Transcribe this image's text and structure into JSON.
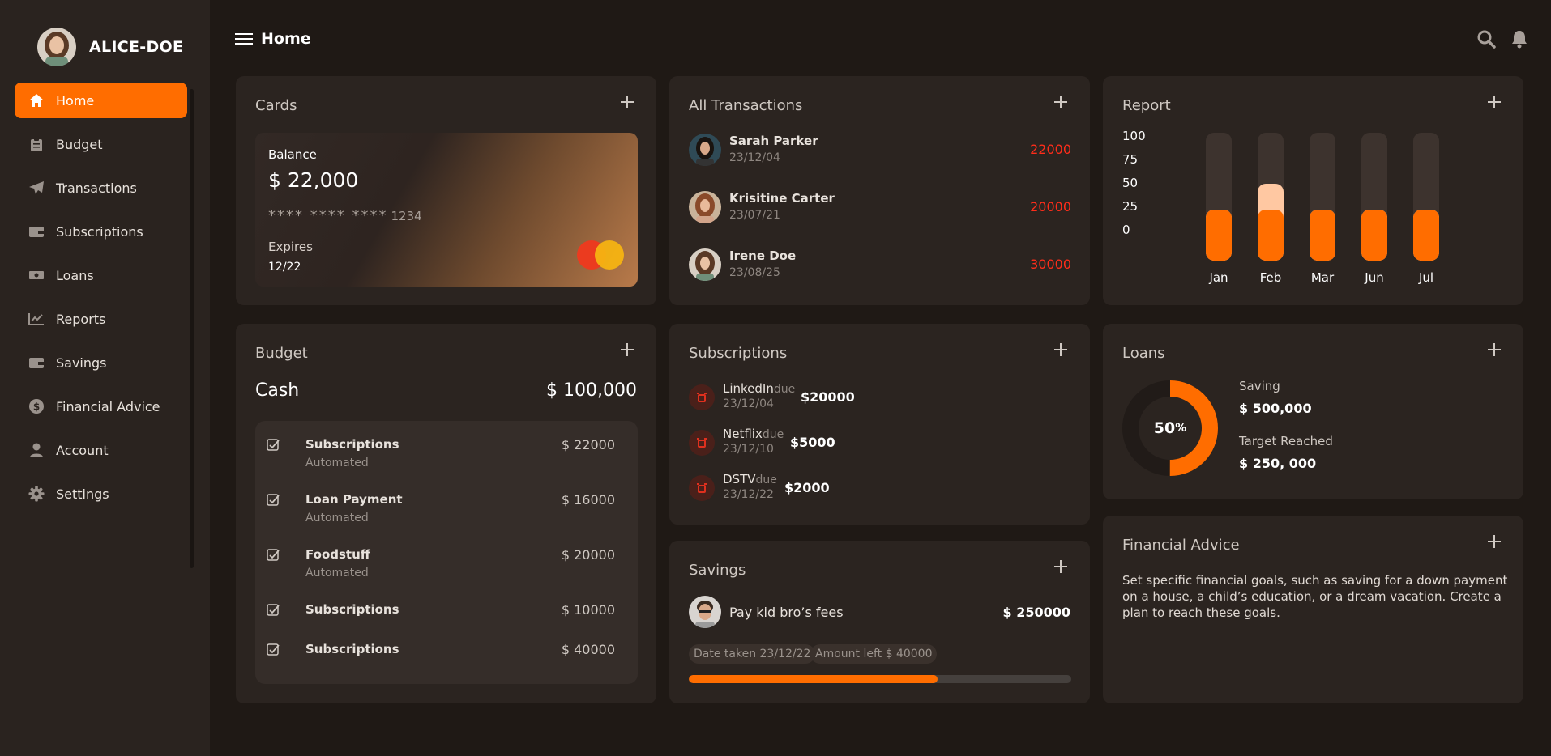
{
  "user": {
    "name": "ALICE-DOE"
  },
  "sidebar": {
    "items": [
      {
        "label": "Home",
        "icon": "home-icon"
      },
      {
        "label": "Budget",
        "icon": "clipboard-icon"
      },
      {
        "label": "Transactions",
        "icon": "paper-plane-icon"
      },
      {
        "label": "Subscriptions",
        "icon": "wallet-icon"
      },
      {
        "label": "Loans",
        "icon": "money-icon"
      },
      {
        "label": "Reports",
        "icon": "chart-line-icon"
      },
      {
        "label": "Savings",
        "icon": "wallet-icon"
      },
      {
        "label": "Financial Advice",
        "icon": "dollar-coin-icon"
      },
      {
        "label": "Account",
        "icon": "user-icon"
      },
      {
        "label": "Settings",
        "icon": "gear-icon"
      }
    ]
  },
  "header": {
    "title": "Home"
  },
  "cards": {
    "title": "Cards",
    "balance_label": "Balance",
    "balance": "$ 22,000",
    "masked": "**** **** ****",
    "last4": "1234",
    "expires_label": "Expires",
    "expires": "12/22"
  },
  "transactions": {
    "title": "All Transactions",
    "items": [
      {
        "name": "Sarah Parker",
        "date": "23/12/04",
        "amount": "22000"
      },
      {
        "name": "Krisitine Carter",
        "date": "23/07/21",
        "amount": "20000"
      },
      {
        "name": "Irene Doe",
        "date": "23/08/25",
        "amount": "30000"
      }
    ]
  },
  "report": {
    "title": "Report"
  },
  "chart_data": {
    "type": "bar",
    "categories": [
      "Jan",
      "Feb",
      "Mar",
      "Jun",
      "Jul"
    ],
    "series": [
      {
        "values": [
          40,
          40,
          40,
          40,
          40
        ],
        "color": "#ff6d00"
      },
      {
        "values": [
          40,
          60,
          40,
          40,
          40
        ],
        "color": "#ffc8a2"
      }
    ],
    "yticks": [
      "100",
      "75",
      "50",
      "25",
      "0"
    ],
    "ylim": [
      0,
      100
    ]
  },
  "budget": {
    "title": "Budget",
    "cash_label": "Cash",
    "cash_value": "$ 100,000",
    "items": [
      {
        "title": "Subscriptions",
        "sub": "Automated",
        "value": "$ 22000"
      },
      {
        "title": "Loan Payment",
        "sub": "Automated",
        "value": "$ 16000"
      },
      {
        "title": "Foodstuff",
        "sub": "Automated",
        "value": "$ 20000"
      },
      {
        "title": "Subscriptions",
        "sub": "",
        "value": "$ 10000"
      },
      {
        "title": "Subscriptions",
        "sub": "",
        "value": "$ 40000"
      }
    ]
  },
  "subscriptions": {
    "title": "Subscriptions",
    "due": "due",
    "items": [
      {
        "name": "LinkedIn",
        "date": "23/12/04",
        "amount": "$20000"
      },
      {
        "name": "Netflix",
        "date": "23/12/10",
        "amount": "$5000"
      },
      {
        "name": "DSTV",
        "date": "23/12/22",
        "amount": "$2000"
      }
    ]
  },
  "savings": {
    "title": "Savings",
    "goal": "Pay kid bro’s fees",
    "amount": "$ 250000",
    "date_chip": "Date taken 23/12/22",
    "left_chip": "Amount left $ 40000",
    "progress": 0.65
  },
  "loans": {
    "title": "Loans",
    "percent": "50",
    "percent_sign": "%",
    "progress": 0.5,
    "saving_label": "Saving",
    "saving_value": "$ 500,000",
    "target_label": "Target Reached",
    "target_value": "$ 250, 000"
  },
  "advice": {
    "title": "Financial Advice",
    "text": "Set specific financial goals, such as saving for a down payment on a house, a child’s education, or a dream vacation. Create a plan to reach these goals."
  },
  "colors": {
    "accent": "#ff6d00",
    "negative": "#ff2d1a",
    "card_bg": "#2b2420",
    "page_bg": "#1f1915"
  }
}
